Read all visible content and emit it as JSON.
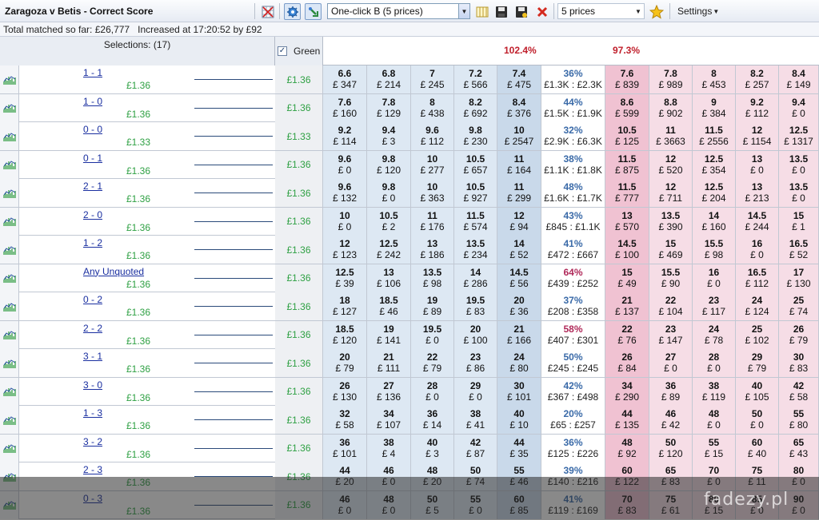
{
  "toolbar": {
    "title": "Zaragoza v Betis - Correct Score",
    "oneclick_value": "One-click B (5 prices)",
    "prices_value": "5 prices",
    "settings_label": "Settings"
  },
  "info": {
    "matched": "Total matched so far: £26,777",
    "increased": "Increased at 17:20:52 by £92"
  },
  "header": {
    "selections": "Selections: (17)",
    "green_label": "Green",
    "back_pct": "102.4%",
    "lay_pct": "97.3%"
  },
  "colors": {
    "back": "#dde8f3",
    "back_best": "#c9d9ea",
    "lay": "#f6dde6",
    "lay_best": "#f0c2d2",
    "green": "#2ea043",
    "red": "#c0202c"
  },
  "rows": [
    {
      "name": "1 - 1",
      "mval": "£1.36",
      "green": "£1.36",
      "back": [
        [
          "6.6",
          "£ 347"
        ],
        [
          "6.8",
          "£ 214"
        ],
        [
          "7",
          "£ 245"
        ],
        [
          "7.2",
          "£ 566"
        ],
        [
          "7.4",
          "£ 475"
        ]
      ],
      "mid_pct": "36%",
      "mid_val": "£1.3K : £2.3K",
      "lay": [
        [
          "7.6",
          "£ 839"
        ],
        [
          "7.8",
          "£ 989"
        ],
        [
          "8",
          "£ 453"
        ],
        [
          "8.2",
          "£ 257"
        ],
        [
          "8.4",
          "£ 149"
        ]
      ]
    },
    {
      "name": "1 - 0",
      "mval": "£1.36",
      "green": "£1.36",
      "back": [
        [
          "7.6",
          "£ 160"
        ],
        [
          "7.8",
          "£ 129"
        ],
        [
          "8",
          "£ 438"
        ],
        [
          "8.2",
          "£ 692"
        ],
        [
          "8.4",
          "£ 376"
        ]
      ],
      "mid_pct": "44%",
      "mid_val": "£1.5K : £1.9K",
      "lay": [
        [
          "8.6",
          "£ 599"
        ],
        [
          "8.8",
          "£ 902"
        ],
        [
          "9",
          "£ 384"
        ],
        [
          "9.2",
          "£ 112"
        ],
        [
          "9.4",
          "£ 0"
        ]
      ]
    },
    {
      "name": "0 - 0",
      "mval": "£1.33",
      "green": "£1.33",
      "back": [
        [
          "9.2",
          "£ 114"
        ],
        [
          "9.4",
          "£ 3"
        ],
        [
          "9.6",
          "£ 112"
        ],
        [
          "9.8",
          "£ 230"
        ],
        [
          "10",
          "£ 2547"
        ]
      ],
      "mid_pct": "32%",
      "mid_val": "£2.9K : £6.3K",
      "lay": [
        [
          "10.5",
          "£ 125"
        ],
        [
          "11",
          "£ 3663"
        ],
        [
          "11.5",
          "£ 2556"
        ],
        [
          "12",
          "£ 1154"
        ],
        [
          "12.5",
          "£ 1317"
        ]
      ]
    },
    {
      "name": "0 - 1",
      "mval": "£1.36",
      "green": "£1.36",
      "back": [
        [
          "9.6",
          "£ 0"
        ],
        [
          "9.8",
          "£ 120"
        ],
        [
          "10",
          "£ 277"
        ],
        [
          "10.5",
          "£ 657"
        ],
        [
          "11",
          "£ 164"
        ]
      ],
      "mid_pct": "38%",
      "mid_val": "£1.1K : £1.8K",
      "lay": [
        [
          "11.5",
          "£ 875"
        ],
        [
          "12",
          "£ 520"
        ],
        [
          "12.5",
          "£ 354"
        ],
        [
          "13",
          "£ 0"
        ],
        [
          "13.5",
          "£ 0"
        ]
      ]
    },
    {
      "name": "2 - 1",
      "mval": "£1.36",
      "green": "£1.36",
      "back": [
        [
          "9.6",
          "£ 132"
        ],
        [
          "9.8",
          "£ 0"
        ],
        [
          "10",
          "£ 363"
        ],
        [
          "10.5",
          "£ 927"
        ],
        [
          "11",
          "£ 299"
        ]
      ],
      "mid_pct": "48%",
      "mid_val": "£1.6K : £1.7K",
      "lay": [
        [
          "11.5",
          "£ 777"
        ],
        [
          "12",
          "£ 711"
        ],
        [
          "12.5",
          "£ 204"
        ],
        [
          "13",
          "£ 213"
        ],
        [
          "13.5",
          "£ 0"
        ]
      ]
    },
    {
      "name": "2 - 0",
      "mval": "£1.36",
      "green": "£1.36",
      "back": [
        [
          "10",
          "£ 0"
        ],
        [
          "10.5",
          "£ 2"
        ],
        [
          "11",
          "£ 176"
        ],
        [
          "11.5",
          "£ 574"
        ],
        [
          "12",
          "£ 94"
        ]
      ],
      "mid_pct": "43%",
      "mid_val": "£845 : £1.1K",
      "lay": [
        [
          "13",
          "£ 570"
        ],
        [
          "13.5",
          "£ 390"
        ],
        [
          "14",
          "£ 160"
        ],
        [
          "14.5",
          "£ 244"
        ],
        [
          "15",
          "£ 1"
        ]
      ]
    },
    {
      "name": "1 - 2",
      "mval": "£1.36",
      "green": "£1.36",
      "back": [
        [
          "12",
          "£ 123"
        ],
        [
          "12.5",
          "£ 242"
        ],
        [
          "13",
          "£ 186"
        ],
        [
          "13.5",
          "£ 234"
        ],
        [
          "14",
          "£ 52"
        ]
      ],
      "mid_pct": "41%",
      "mid_val": "£472 : £667",
      "lay": [
        [
          "14.5",
          "£ 100"
        ],
        [
          "15",
          "£ 469"
        ],
        [
          "15.5",
          "£ 98"
        ],
        [
          "16",
          "£ 0"
        ],
        [
          "16.5",
          "£ 52"
        ]
      ]
    },
    {
      "name": "Any Unquoted",
      "mval": "£1.36",
      "green": "£1.36",
      "back": [
        [
          "12.5",
          "£ 39"
        ],
        [
          "13",
          "£ 106"
        ],
        [
          "13.5",
          "£ 98"
        ],
        [
          "14",
          "£ 286"
        ],
        [
          "14.5",
          "£ 56"
        ]
      ],
      "mid_pct": "64%",
      "mid_val": "£439 : £252",
      "mid_red": true,
      "lay": [
        [
          "15",
          "£ 49"
        ],
        [
          "15.5",
          "£ 90"
        ],
        [
          "16",
          "£ 0"
        ],
        [
          "16.5",
          "£ 112"
        ],
        [
          "17",
          "£ 130"
        ]
      ]
    },
    {
      "name": "0 - 2",
      "mval": "£1.36",
      "green": "£1.36",
      "back": [
        [
          "18",
          "£ 127"
        ],
        [
          "18.5",
          "£ 46"
        ],
        [
          "19",
          "£ 89"
        ],
        [
          "19.5",
          "£ 83"
        ],
        [
          "20",
          "£ 36"
        ]
      ],
      "mid_pct": "37%",
      "mid_val": "£208 : £358",
      "lay": [
        [
          "21",
          "£ 137"
        ],
        [
          "22",
          "£ 104"
        ],
        [
          "23",
          "£ 117"
        ],
        [
          "24",
          "£ 124"
        ],
        [
          "25",
          "£ 74"
        ]
      ]
    },
    {
      "name": "2 - 2",
      "mval": "£1.36",
      "green": "£1.36",
      "back": [
        [
          "18.5",
          "£ 120"
        ],
        [
          "19",
          "£ 141"
        ],
        [
          "19.5",
          "£ 0"
        ],
        [
          "20",
          "£ 100"
        ],
        [
          "21",
          "£ 166"
        ]
      ],
      "mid_pct": "58%",
      "mid_val": "£407 : £301",
      "mid_red": true,
      "lay": [
        [
          "22",
          "£ 76"
        ],
        [
          "23",
          "£ 147"
        ],
        [
          "24",
          "£ 78"
        ],
        [
          "25",
          "£ 102"
        ],
        [
          "26",
          "£ 79"
        ]
      ]
    },
    {
      "name": "3 - 1",
      "mval": "£1.36",
      "green": "£1.36",
      "back": [
        [
          "20",
          "£ 79"
        ],
        [
          "21",
          "£ 111"
        ],
        [
          "22",
          "£ 79"
        ],
        [
          "23",
          "£ 86"
        ],
        [
          "24",
          "£ 80"
        ]
      ],
      "mid_pct": "50%",
      "mid_val": "£245 : £245",
      "lay": [
        [
          "26",
          "£ 84"
        ],
        [
          "27",
          "£ 0"
        ],
        [
          "28",
          "£ 0"
        ],
        [
          "29",
          "£ 79"
        ],
        [
          "30",
          "£ 83"
        ]
      ]
    },
    {
      "name": "3 - 0",
      "mval": "£1.36",
      "green": "£1.36",
      "back": [
        [
          "26",
          "£ 130"
        ],
        [
          "27",
          "£ 136"
        ],
        [
          "28",
          "£ 0"
        ],
        [
          "29",
          "£ 0"
        ],
        [
          "30",
          "£ 101"
        ]
      ],
      "mid_pct": "42%",
      "mid_val": "£367 : £498",
      "lay": [
        [
          "34",
          "£ 290"
        ],
        [
          "36",
          "£ 89"
        ],
        [
          "38",
          "£ 119"
        ],
        [
          "40",
          "£ 105"
        ],
        [
          "42",
          "£ 58"
        ]
      ]
    },
    {
      "name": "1 - 3",
      "mval": "£1.36",
      "green": "£1.36",
      "back": [
        [
          "32",
          "£ 58"
        ],
        [
          "34",
          "£ 107"
        ],
        [
          "36",
          "£ 14"
        ],
        [
          "38",
          "£ 41"
        ],
        [
          "40",
          "£ 10"
        ]
      ],
      "mid_pct": "20%",
      "mid_val": "£65 : £257",
      "lay": [
        [
          "44",
          "£ 135"
        ],
        [
          "46",
          "£ 42"
        ],
        [
          "48",
          "£ 0"
        ],
        [
          "50",
          "£ 0"
        ],
        [
          "55",
          "£ 80"
        ]
      ]
    },
    {
      "name": "3 - 2",
      "mval": "£1.36",
      "green": "£1.36",
      "back": [
        [
          "36",
          "£ 101"
        ],
        [
          "38",
          "£ 4"
        ],
        [
          "40",
          "£ 3"
        ],
        [
          "42",
          "£ 87"
        ],
        [
          "44",
          "£ 35"
        ]
      ],
      "mid_pct": "36%",
      "mid_val": "£125 : £226",
      "lay": [
        [
          "48",
          "£ 92"
        ],
        [
          "50",
          "£ 120"
        ],
        [
          "55",
          "£ 15"
        ],
        [
          "60",
          "£ 40"
        ],
        [
          "65",
          "£ 43"
        ]
      ]
    },
    {
      "name": "2 - 3",
      "mval": "£1.36",
      "green": "£1.36",
      "back": [
        [
          "44",
          "£ 20"
        ],
        [
          "46",
          "£ 0"
        ],
        [
          "48",
          "£ 20"
        ],
        [
          "50",
          "£ 74"
        ],
        [
          "55",
          "£ 46"
        ]
      ],
      "mid_pct": "39%",
      "mid_val": "£140 : £216",
      "lay": [
        [
          "60",
          "£ 122"
        ],
        [
          "65",
          "£ 83"
        ],
        [
          "70",
          "£ 0"
        ],
        [
          "75",
          "£ 11"
        ],
        [
          "80",
          "£ 0"
        ]
      ]
    },
    {
      "name": "0 - 3",
      "mval": "£1.36",
      "green": "£1.36",
      "back": [
        [
          "46",
          "£ 0"
        ],
        [
          "48",
          "£ 0"
        ],
        [
          "50",
          "£ 5"
        ],
        [
          "55",
          "£ 0"
        ],
        [
          "60",
          "£ 85"
        ]
      ],
      "mid_pct": "41%",
      "mid_val": "£119 : £169",
      "lay": [
        [
          "70",
          "£ 83"
        ],
        [
          "75",
          "£ 61"
        ],
        [
          "80",
          "£ 15"
        ],
        [
          "85",
          "£ 0"
        ],
        [
          "90",
          "£ 0"
        ]
      ]
    }
  ],
  "watermark": "fadezy.pl"
}
